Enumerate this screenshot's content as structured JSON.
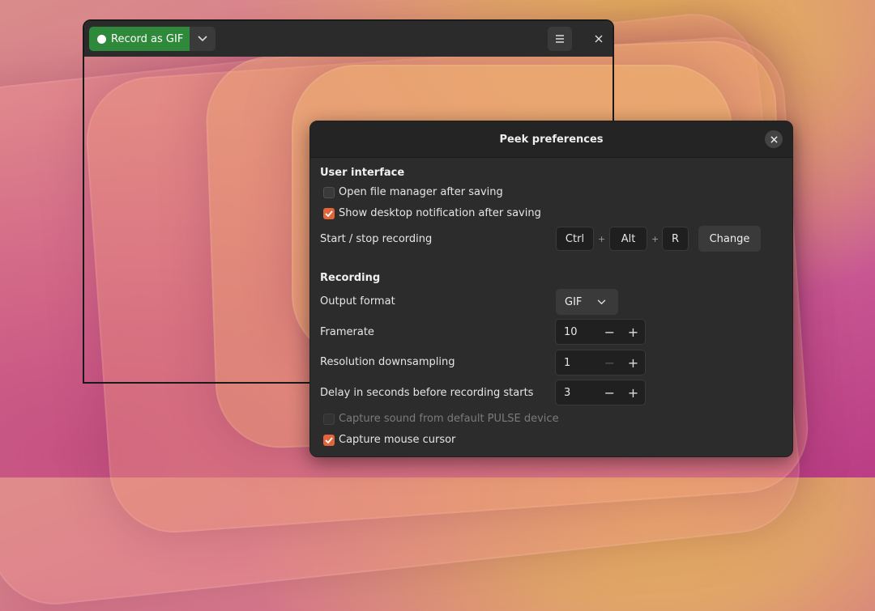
{
  "main_window": {
    "record_label": "Record as GIF",
    "icons": {
      "record": "record-dot-icon",
      "dropdown": "chevron-down-icon",
      "menu": "hamburger-menu-icon",
      "close": "close-icon"
    }
  },
  "preferences": {
    "title": "Peek preferences",
    "user_interface": {
      "heading": "User interface",
      "open_file_manager": {
        "label": "Open file manager after saving",
        "checked": false
      },
      "show_notification": {
        "label": "Show desktop notification after saving",
        "checked": true
      },
      "shortcut": {
        "label": "Start / stop recording",
        "keys": [
          "Ctrl",
          "Alt",
          "R"
        ],
        "separator": "+",
        "change_label": "Change"
      }
    },
    "recording": {
      "heading": "Recording",
      "output_format": {
        "label": "Output format",
        "value": "GIF"
      },
      "framerate": {
        "label": "Framerate",
        "value": "10"
      },
      "downsampling": {
        "label": "Resolution downsampling",
        "value": "1"
      },
      "delay": {
        "label": "Delay in seconds before recording starts",
        "value": "3"
      },
      "capture_sound": {
        "label": "Capture sound from default PULSE device",
        "checked": false,
        "disabled": true
      },
      "capture_cursor": {
        "label": "Capture mouse cursor",
        "checked": true
      }
    },
    "spin_minus": "−",
    "spin_plus": "+"
  },
  "colors": {
    "record_green": "#2e8a3a",
    "accent_orange": "#e0663a",
    "dialog_bg": "#2c2c2c"
  }
}
